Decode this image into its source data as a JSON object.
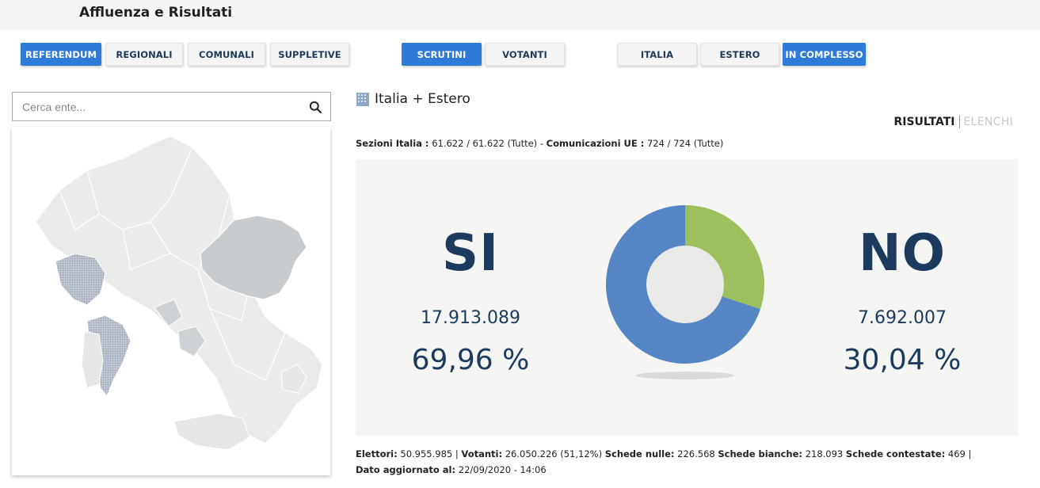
{
  "header": {
    "title": "Affluenza e Risultati"
  },
  "election_tabs": [
    "REFERENDUM",
    "REGIONALI",
    "COMUNALI",
    "SUPPLETIVE"
  ],
  "data_tabs": [
    "SCRUTINI",
    "VOTANTI"
  ],
  "area_tabs": [
    "ITALIA",
    "ESTERO",
    "IN COMPLESSO"
  ],
  "search": {
    "placeholder": "Cerca ente..."
  },
  "result": {
    "title": "Italia + Estero",
    "toggle": {
      "results": "RISULTATI",
      "lists": "ELENCHI"
    },
    "sections": {
      "italy_label": "Sezioni Italia :",
      "italy_value": "61.622 / 61.622 (Tutte)",
      "sep": "-",
      "ue_label": "Comunicazioni UE :",
      "ue_value": "724 / 724 (Tutte)"
    },
    "yes": {
      "label": "SI",
      "count": "17.913.089",
      "pct": "69,96 %"
    },
    "no": {
      "label": "NO",
      "count": "7.692.007",
      "pct": "30,04 %"
    },
    "footer": {
      "electors_label": "Elettori:",
      "electors_value": "50.955.985",
      "voters_label": "Votanti:",
      "voters_value": "26.050.226 (51,12%)",
      "null_label": "Schede nulle:",
      "null_value": "226.568",
      "blank_label": "Schede bianche:",
      "blank_value": "218.093",
      "contested_label": "Schede contestate:",
      "contested_value": "469",
      "updated_label": "Dato aggiornato al:",
      "updated_value": "22/09/2020 - 14:06"
    }
  },
  "colors": {
    "yes": "#5486c5",
    "no": "#9dbf5e",
    "accent": "#2f7bd8",
    "text_dark": "#1b3a5e"
  },
  "chart_data": {
    "type": "pie",
    "categories": [
      "SI",
      "NO"
    ],
    "values": [
      69.96,
      30.04
    ]
  }
}
